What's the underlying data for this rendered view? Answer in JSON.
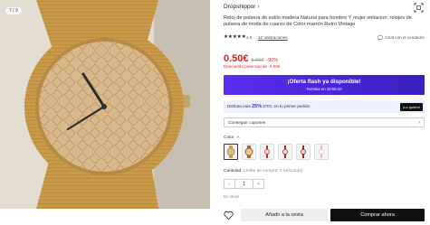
{
  "gallery": {
    "counter": "7 / 9"
  },
  "store": {
    "name": "Dropshippor"
  },
  "product": {
    "title": "Reloj de pulsera de estilo madera Natural para hombre Y mujer imitacion, relojes de pulsera de moda de cuarzo de Color marrón Retro Vintage",
    "rating": "4.6",
    "valuations": "12 Valoraciones",
    "chat_seller": "Chat con el vendedor"
  },
  "pricing": {
    "price": "0.50€",
    "old_price": "5.00€",
    "discount": "-90%",
    "potential_discount": "Descuento potencial de -4.50€"
  },
  "flash": {
    "title": "¡Oferta flash ya disponible!",
    "timer": "Termina en 19:55:10"
  },
  "coupon_bar": {
    "prefix": "Disfruta más",
    "percent": "25%",
    "suffix": "DTO. en tu primer pedido",
    "button": "¡Lo quiero!"
  },
  "coupons": {
    "label": "Conseguir cupones"
  },
  "color": {
    "label": "Color",
    "value": "A"
  },
  "quantity": {
    "label": "Cantidad",
    "limit": "Límite de compra: 2 artículo(s)",
    "value": "1",
    "minus": "−",
    "plus": "+"
  },
  "stock": {
    "text": "En stock"
  },
  "actions": {
    "add_to_cart": "Añadir a la cesta",
    "buy_now": "Comprar ahora"
  },
  "colors": {
    "accent": "#e41e1e",
    "flash_bg": "#4a26e0",
    "buy_bg": "#111111"
  }
}
